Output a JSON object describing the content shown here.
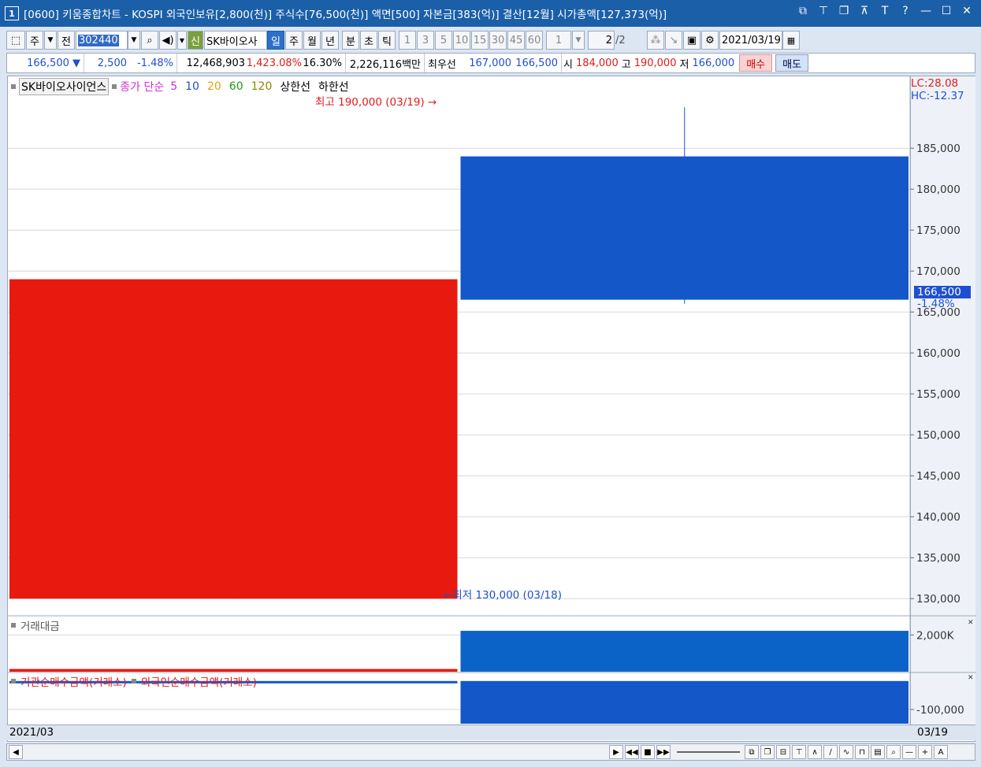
{
  "window": {
    "num": "1",
    "title": "[0600] 키움종합차트 - KOSPI 외국인보유[2,800(천)] 주식수[76,500(천)] 액면[500] 자본금[383(억)] 결산[12월] 시가총액[127,373(억)]",
    "btns": [
      "⧉",
      "⊤",
      "❐",
      "⊼",
      "T",
      "?",
      "—",
      "☐",
      "✕"
    ]
  },
  "toolbar": {
    "stock_type": "주",
    "all": "전",
    "code": "302440",
    "stock_flag": "신",
    "stock_name": "SK바이오사",
    "periods": [
      "일",
      "주",
      "월",
      "년",
      "분",
      "초",
      "틱"
    ],
    "active_period": "일",
    "intervals": [
      "1",
      "3",
      "5",
      "10",
      "15",
      "30",
      "45",
      "60"
    ],
    "count": "1",
    "page": "2",
    "page_total": "/2",
    "date": "2021/03/19"
  },
  "quote": {
    "price": "166,500 ▼",
    "change": "2,500",
    "rate": "-1.48%",
    "volume": "12,468,903",
    "vol_rate": "1,423.08%",
    "turnover": "16.30%",
    "amount": "2,226,116백만",
    "best_label": "최우선",
    "best_ask": "167,000",
    "best_bid": "166,500",
    "open_label": "시",
    "open": "184,000",
    "high_label": "고",
    "high": "190,000",
    "low_label": "저",
    "low": "166,000",
    "buy": "매수",
    "sell": "매도"
  },
  "legend": {
    "name": "SK바이오사이언스",
    "close": "종가 단순",
    "ma": [
      "5",
      "10",
      "20",
      "60",
      "120"
    ],
    "upper": "상한선",
    "lower": "하한선",
    "ma_colors": [
      "#d12fd1",
      "#1f4fd0",
      "#e8a400",
      "#1a9a1a",
      "#8a8a00"
    ]
  },
  "lchc": {
    "lc": "LC:28.08",
    "hc": "HC:-12.37"
  },
  "annotations": {
    "high": "최고 190,000 (03/19)",
    "low": "최저 130,000 (03/18)"
  },
  "current": {
    "price": "166,500",
    "rate": "-1.48%"
  },
  "panel2": {
    "title": "거래대금",
    "tick": "2,000K"
  },
  "panel3": {
    "title_a": "기관순매수금액(거래소)",
    "title_b": "외국인순매수금액(거래소)",
    "tick": "-100,000"
  },
  "status": {
    "left": "2021/03",
    "right": "03/19"
  },
  "chart_data": {
    "type": "candlestick",
    "categories": [
      "03/18",
      "03/19"
    ],
    "ohlc": [
      {
        "date": "03/18",
        "open": 130000,
        "high": 169000,
        "low": 130000,
        "close": 169000
      },
      {
        "date": "03/19",
        "open": 184000,
        "high": 190000,
        "low": 166000,
        "close": 166500
      }
    ],
    "yticks": [
      130000,
      135000,
      140000,
      145000,
      150000,
      155000,
      160000,
      165000,
      170000,
      175000,
      180000,
      185000
    ],
    "ytick_labels": [
      "130,000",
      "135,000",
      "140,000",
      "145,000",
      "150,000",
      "155,000",
      "160,000",
      "165,000",
      "170,000",
      "175,000",
      "180,000",
      "185,000"
    ],
    "ylim": [
      128000,
      193000
    ],
    "up_color": "#e8190e",
    "down_color": "#1357c9",
    "volume_amount": [
      {
        "date": "03/18",
        "value": 150
      },
      {
        "date": "03/19",
        "value": 2226
      }
    ],
    "volume_ylim": [
      0,
      2400
    ],
    "volume_tick": 2000,
    "netbuy": [
      {
        "date": "03/18",
        "inst": -2000,
        "foreign": -4000
      },
      {
        "date": "03/19",
        "inst": -5000,
        "foreign": -150000
      }
    ],
    "netbuy_ylim": [
      -150000,
      5000
    ],
    "netbuy_tick": -100000
  }
}
